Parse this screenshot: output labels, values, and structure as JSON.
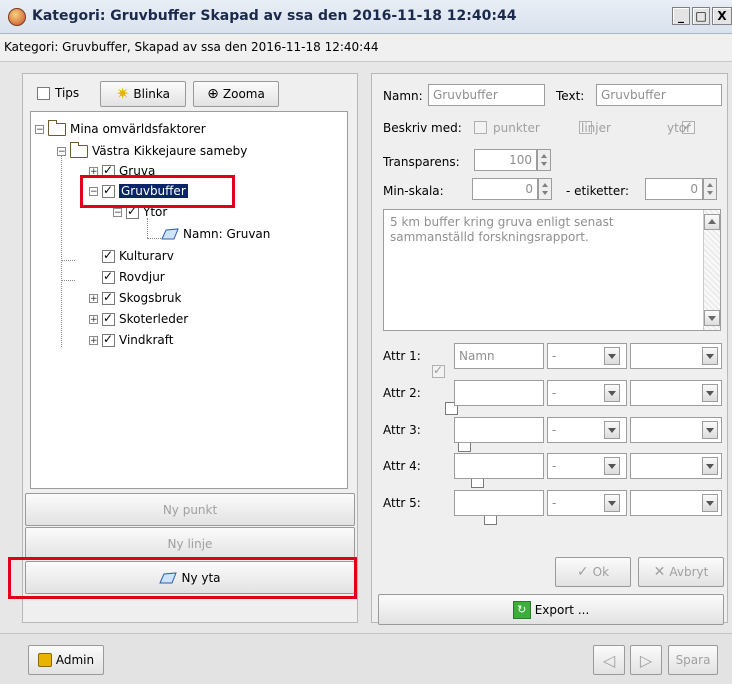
{
  "window": {
    "title": "Kategori: Gruvbuffer Skapad av ssa den 2016-11-18 12:40:44",
    "subtitle": "Kategori: Gruvbuffer, Skapad av ssa den 2016-11-18 12:40:44",
    "controls": [
      "_",
      "□",
      "X"
    ]
  },
  "toolbar": {
    "tips_label": "Tips",
    "blinka_label": "Blinka",
    "zooma_label": "Zooma"
  },
  "tree": {
    "root": "Mina omvärldsfaktorer",
    "group": "Västra Kikkejaure sameby",
    "items": {
      "gruva": "Gruva",
      "gruvbuffer": "Gruvbuffer",
      "ytor": "Ytor",
      "namn_gruvan": "Namn: Gruvan",
      "kulturarv": "Kulturarv",
      "rovdjur": "Rovdjur",
      "skogsbruk": "Skogsbruk",
      "skoterleder": "Skoterleder",
      "vindkraft": "Vindkraft"
    }
  },
  "left_buttons": {
    "ny_punkt": "Ny punkt",
    "ny_linje": "Ny linje",
    "ny_yta": "Ny yta"
  },
  "form": {
    "namn_label": "Namn:",
    "namn_value": "Gruvbuffer",
    "text_label": "Text:",
    "text_value": "Gruvbuffer",
    "beskriv_label": "Beskriv med:",
    "punkter_label": "punkter",
    "linjer_label": "linjer",
    "ytor_label": "ytor",
    "transparens_label": "Transparens:",
    "transparens_value": "100",
    "minskala_label": "Min-skala:",
    "minskala_value": "0",
    "etiketter_label": "- etiketter:",
    "etiketter_value": "0",
    "description": "5 km buffer kring gruva enligt senast sammanställd forskningsrapport."
  },
  "attrs": [
    {
      "label": "Attr 1:",
      "name": "Namn",
      "type": "-"
    },
    {
      "label": "Attr 2:",
      "name": "",
      "type": "-"
    },
    {
      "label": "Attr 3:",
      "name": "",
      "type": "-"
    },
    {
      "label": "Attr 4:",
      "name": "",
      "type": "-"
    },
    {
      "label": "Attr 5:",
      "name": "",
      "type": "-"
    }
  ],
  "actions": {
    "ok": "Ok",
    "avbryt": "Avbryt",
    "export": "Export ..."
  },
  "footer": {
    "admin": "Admin",
    "spara": "Spara"
  }
}
